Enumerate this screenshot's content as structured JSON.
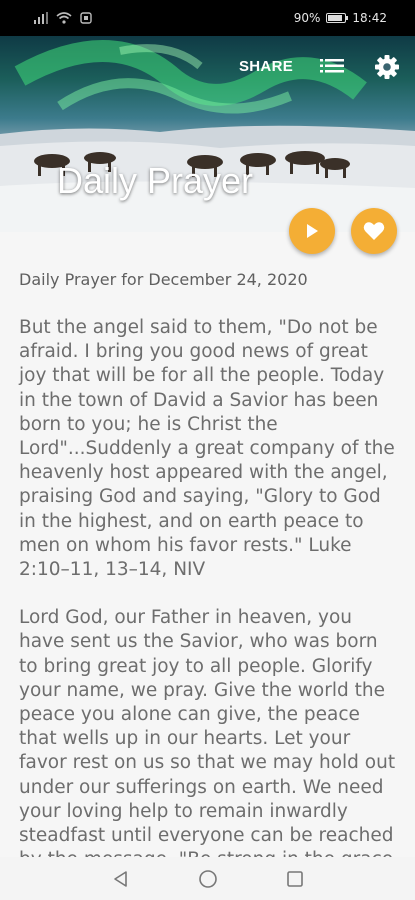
{
  "status_bar": {
    "left_icons": [
      "signal-icon",
      "wifi-icon",
      "notification-icon"
    ],
    "battery_text": "90%",
    "battery_level": 0.9,
    "time": "18:42"
  },
  "header": {
    "title": "Daily Prayer",
    "share_label": "SHARE",
    "list_icon": "list-icon",
    "settings_icon": "gear-icon"
  },
  "actions": {
    "play_icon": "play-icon",
    "favorite_icon": "heart-icon",
    "accent": "#f4ae35"
  },
  "content": {
    "date_line": "Daily Prayer for December 24, 2020",
    "paragraphs": [
      "But the angel said to them, \"Do not be afraid. I bring you good news of great joy that will be for all the people. Today in the town of David a Savior has been born to you; he is Christ the Lord\"...Suddenly a great company of the heavenly host appeared with the angel, praising God and saying, \"Glory to God in the highest, and on earth peace to men on whom his favor rests.\" Luke 2:10–11, 13–14, NIV",
      "Lord God, our Father in heaven, you have sent us the Savior, who was born to bring great joy to all people. Glorify your name, we pray. Give the world the peace you alone can give, the peace that wells up in our hearts. Let your favor rest on us so that we may hold out under our sufferings on earth. We need your loving help to remain inwardly steadfast until everyone can be reached by the message, \"Be strong in the grace of Jesus Christ.\" Amen."
    ]
  },
  "nav_bar": {
    "back_icon": "back-triangle-icon",
    "home_icon": "home-circle-icon",
    "recents_icon": "recents-square-icon"
  }
}
